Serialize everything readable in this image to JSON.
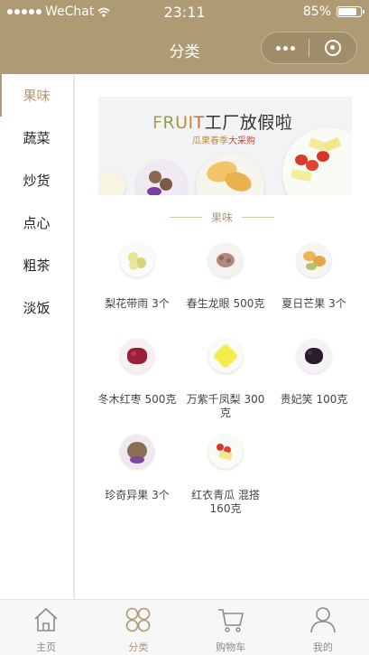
{
  "status_bar": {
    "carrier": "WeChat",
    "time": "23:11",
    "battery": "85%",
    "battery_level": 0.85
  },
  "nav": {
    "title": "分类"
  },
  "sidebar": {
    "items": [
      {
        "label": "果味",
        "active": true
      },
      {
        "label": "蔬菜",
        "active": false
      },
      {
        "label": "炒货",
        "active": false
      },
      {
        "label": "点心",
        "active": false
      },
      {
        "label": "粗茶",
        "active": false
      },
      {
        "label": "淡饭",
        "active": false
      }
    ]
  },
  "banner": {
    "title_prefix": "FRUIT",
    "title_suffix": "工厂放假啦",
    "subtitle_a": "瓜果春季",
    "subtitle_b": "大采购"
  },
  "section": {
    "title": "果味"
  },
  "products": [
    {
      "name": "梨花带雨 3个",
      "icon": "pear-plate-icon"
    },
    {
      "name": "春生龙眼 500克",
      "icon": "longan-plate-icon"
    },
    {
      "name": "夏日芒果 3个",
      "icon": "mango-plate-icon"
    },
    {
      "name": "冬木红枣 500克",
      "icon": "red-date-plate-icon"
    },
    {
      "name": "万紫千凤梨 300克",
      "icon": "pineapple-plate-icon"
    },
    {
      "name": "贵妃笑 100克",
      "icon": "lychee-plate-icon"
    },
    {
      "name": "珍奇异果 3个",
      "icon": "kiwi-plate-icon"
    },
    {
      "name": "红衣青瓜 混搭160克",
      "icon": "melon-mix-plate-icon"
    }
  ],
  "tabbar": {
    "items": [
      {
        "label": "主页",
        "icon": "home-icon",
        "active": false
      },
      {
        "label": "分类",
        "icon": "category-icon",
        "active": true
      },
      {
        "label": "购物车",
        "icon": "cart-icon",
        "active": false
      },
      {
        "label": "我的",
        "icon": "user-icon",
        "active": false
      }
    ]
  },
  "colors": {
    "accent": "#ae9a73",
    "tab_inactive": "#8a8a8a",
    "sidebar_divider": "#e6e6e6"
  }
}
